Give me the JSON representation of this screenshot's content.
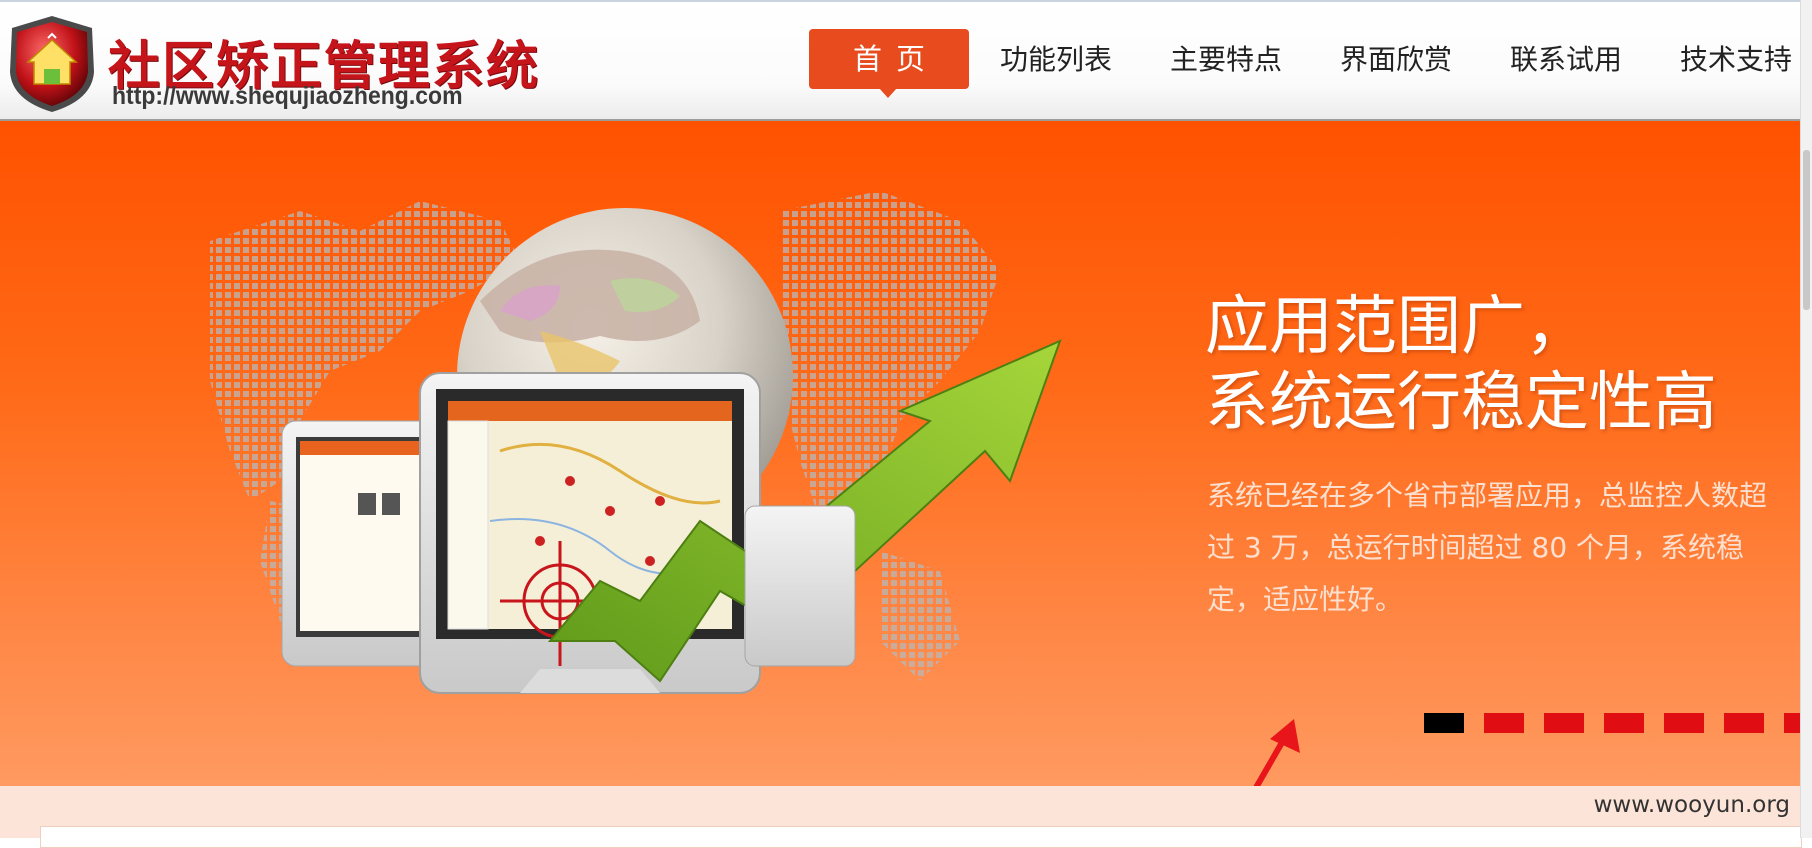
{
  "site": {
    "title": "社区矫正管理系统",
    "url": "http://www.shequjiaozheng.com"
  },
  "nav": {
    "items": [
      "首页",
      "功能列表",
      "主要特点",
      "界面欣赏",
      "联系试用",
      "技术支持"
    ],
    "active_index": 0
  },
  "banner": {
    "headline_line1": "应用范围广，",
    "headline_line2": "系统运行稳定性高",
    "description": "系统已经在多个省市部署应用，总监控人数超过 3 万，总运行时间超过 80 个月，系统稳定，适应性好。",
    "slide_count": 7,
    "active_slide": 0
  },
  "watermark": "www.wooyun.org",
  "colors": {
    "accent": "#e84b1e",
    "banner": "#ff5a0a",
    "brand_red": "#c6141b",
    "dot_red": "#e00d12"
  },
  "icons": [
    "house-shield-logo-icon",
    "globe-icon",
    "growth-arrow-icon",
    "red-pointer-arrow-icon"
  ]
}
